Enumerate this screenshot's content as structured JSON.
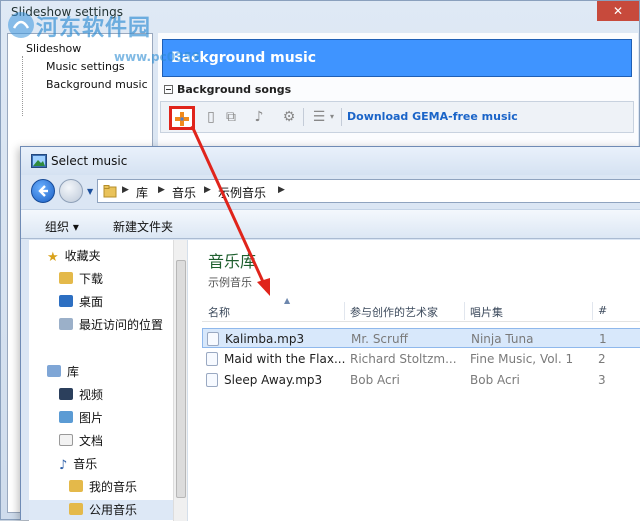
{
  "background_window": {
    "title": "Slideshow settings",
    "tree": [
      {
        "label": "Slideshow"
      },
      {
        "label": "Music settings"
      },
      {
        "label": "Background music"
      }
    ],
    "header": "Background music",
    "section_label": "Background songs",
    "toolbar": {
      "download_label": "Download GEMA-free music",
      "icons": [
        "add-icon",
        "delete-icon",
        "copy-icon",
        "audio-icon",
        "settings-icon",
        "list-icon"
      ]
    }
  },
  "watermark": {
    "text": "河东软件园",
    "url": "www.pc0359"
  },
  "dialog": {
    "title": "Select music",
    "address": {
      "crumbs": [
        "库",
        "音乐",
        "示例音乐"
      ]
    },
    "command_bar": {
      "organize": "组织 ▾",
      "new_folder": "新建文件夹"
    },
    "nav": {
      "favorites": {
        "label": "收藏夹",
        "items": [
          {
            "label": "下载"
          },
          {
            "label": "桌面"
          },
          {
            "label": "最近访问的位置"
          }
        ]
      },
      "libraries": {
        "label": "库",
        "items": [
          {
            "label": "视频"
          },
          {
            "label": "图片"
          },
          {
            "label": "文档"
          },
          {
            "label": "音乐"
          },
          {
            "label": "我的音乐"
          },
          {
            "label": "公用音乐"
          }
        ]
      }
    },
    "library": {
      "title": "音乐库",
      "subtitle": "示例音乐"
    },
    "columns": [
      "名称",
      "参与创作的艺术家",
      "唱片集",
      "#"
    ],
    "files": [
      {
        "name": "Kalimba.mp3",
        "artist": "Mr. Scruff",
        "album": "Ninja Tuna",
        "track": "1"
      },
      {
        "name": "Maid with the Flax...",
        "artist": "Richard Stoltzm...",
        "album": "Fine Music, Vol. 1",
        "track": "2"
      },
      {
        "name": "Sleep Away.mp3",
        "artist": "Bob Acri",
        "album": "Bob Acri",
        "track": "3"
      }
    ]
  },
  "colors": {
    "header_blue": "#3f94ff",
    "annotation_red": "#e0241b",
    "library_green": "#1e5f2e"
  }
}
